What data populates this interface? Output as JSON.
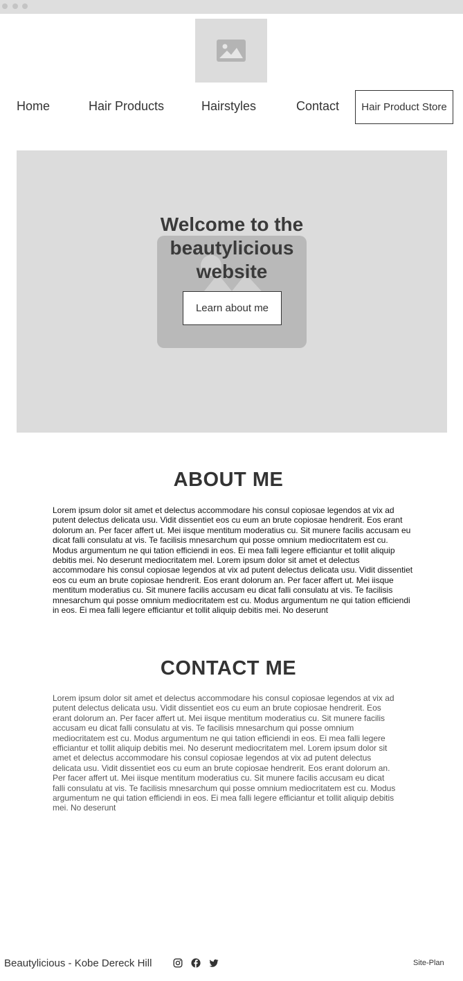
{
  "nav": {
    "items": [
      {
        "label": "Home"
      },
      {
        "label": "Hair Products"
      },
      {
        "label": "Hairstyles"
      },
      {
        "label": "Contact"
      }
    ],
    "store_button": "Hair Product Store"
  },
  "hero": {
    "title": "Welcome to the beautylicious website",
    "button": "Learn about me"
  },
  "about": {
    "title": "ABOUT ME",
    "text": "Lorem ipsum dolor sit amet et delectus accommodare his consul copiosae legendos at vix ad putent delectus delicata usu. Vidit dissentiet eos cu eum an brute copiosae hendrerit. Eos erant dolorum an. Per facer affert ut. Mei iisque mentitum moderatius cu. Sit munere facilis accusam eu dicat falli consulatu at vis. Te facilisis mnesarchum qui posse omnium mediocritatem est cu. Modus argumentum ne qui tation efficiendi in eos. Ei mea falli legere efficiantur et tollit aliquip debitis mei. No deserunt mediocritatem mel. Lorem ipsum dolor sit amet et delectus accommodare his consul copiosae legendos at vix ad putent delectus delicata usu. Vidit dissentiet eos cu eum an brute copiosae hendrerit. Eos erant dolorum an. Per facer affert ut. Mei iisque mentitum moderatius cu. Sit munere facilis accusam eu dicat falli consulatu at vis. Te facilisis mnesarchum qui posse omnium mediocritatem est cu. Modus argumentum ne qui tation efficiendi in eos. Ei mea falli legere efficiantur et tollit aliquip debitis mei. No deserunt"
  },
  "contact": {
    "title": "CONTACT ME",
    "text": "Lorem ipsum dolor sit amet et delectus accommodare his consul copiosae legendos at vix ad putent delectus delicata usu. Vidit dissentiet eos cu eum an brute copiosae hendrerit. Eos erant dolorum an. Per facer affert ut. Mei iisque mentitum moderatius cu. Sit munere facilis accusam eu dicat falli consulatu at vis. Te facilisis mnesarchum qui posse omnium mediocritatem est cu. Modus argumentum ne qui tation efficiendi in eos. Ei mea falli legere efficiantur et tollit aliquip debitis mei. No deserunt mediocritatem mel. Lorem ipsum dolor sit amet et delectus accommodare his consul copiosae legendos at vix ad putent delectus delicata usu. Vidit dissentiet eos cu eum an brute copiosae hendrerit. Eos erant dolorum an. Per facer affert ut. Mei iisque mentitum moderatius cu. Sit munere facilis accusam eu dicat falli consulatu at vis. Te facilisis mnesarchum qui posse omnium mediocritatem est cu. Modus argumentum ne qui tation efficiendi in eos. Ei mea falli legere efficiantur et tollit aliquip debitis mei. No deserunt"
  },
  "footer": {
    "name": "Beautylicious - Kobe Dereck Hill",
    "social_icons": [
      "instagram-icon",
      "facebook-icon",
      "twitter-icon"
    ],
    "site_plan": "Site-Plan"
  },
  "colors": {
    "text": "#333333",
    "placeholder": "#dcdcdc",
    "placeholder_dark": "#b9b9b9"
  }
}
